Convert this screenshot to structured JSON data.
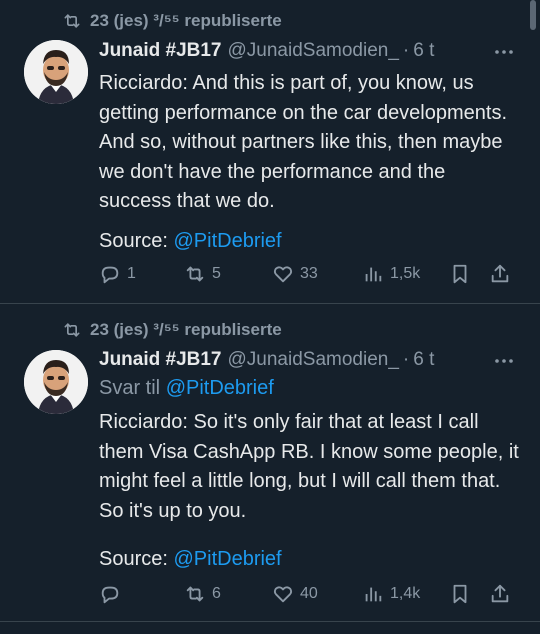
{
  "colors": {
    "background": "#15202b",
    "text": "#e7e9ea",
    "muted": "#8b98a5",
    "link": "#1d9bf0",
    "divider": "#38444d"
  },
  "tweets": [
    {
      "repost": "23 (jes) ³/⁵⁵ republiserte",
      "name": "Junaid #JB17",
      "handle": "@JunaidSamodien_",
      "time": "6 t",
      "reply_to_label": "",
      "reply_to_handle": "",
      "text": "Ricciardo: And this is part of, you know, us getting performance on the car developments. And so, without partners like this, then maybe we don't have the performance and the success that we do.",
      "source_label": "Source:",
      "source_handle": "@PitDebrief",
      "replies": "1",
      "reposts": "5",
      "likes": "33",
      "views": "1,5k"
    },
    {
      "repost": "23 (jes) ³/⁵⁵ republiserte",
      "name": "Junaid #JB17",
      "handle": "@JunaidSamodien_",
      "time": "6 t",
      "reply_to_label": "Svar til",
      "reply_to_handle": "@PitDebrief",
      "text": "Ricciardo: So it's only fair that at least I call them Visa CashApp RB. I know some people, it might feel a little long, but I will call them that. So it's up to you.",
      "source_label": "Source:",
      "source_handle": "@PitDebrief",
      "replies": "",
      "reposts": "6",
      "likes": "40",
      "views": "1,4k"
    }
  ],
  "icons": {
    "repost": "repost-icon",
    "reply": "reply-icon",
    "like": "heart-icon",
    "views": "views-icon",
    "bookmark": "bookmark-icon",
    "share": "share-icon",
    "more": "more-icon"
  }
}
